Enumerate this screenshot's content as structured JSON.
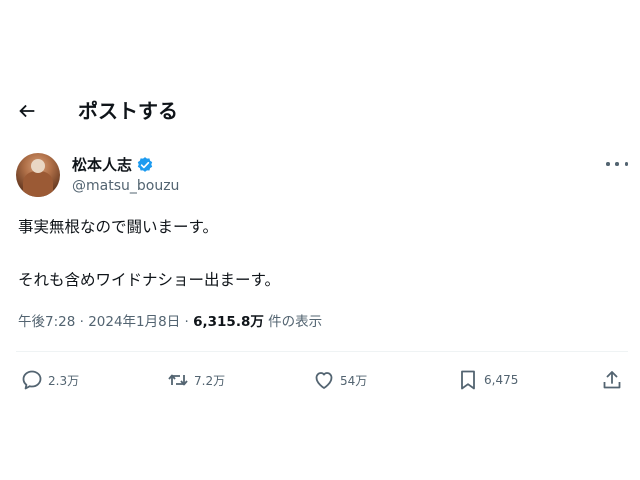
{
  "header": {
    "title": "ポストする",
    "back_icon": "arrow-left-icon"
  },
  "author": {
    "name": "松本人志",
    "handle": "@matsu_bouzu",
    "verified_color": "#1d9bf0"
  },
  "post": {
    "line1": "事実無根なので闘いまーす。",
    "line2": "それも含めワイドナショー出まーす。"
  },
  "meta": {
    "time": "午後7:28",
    "sep1": " · ",
    "date": "2024年1月8日",
    "sep2": " · ",
    "views": "6,315.8万",
    "views_label": " 件の表示"
  },
  "actions": {
    "replies": "2.3万",
    "reposts": "7.2万",
    "likes": "54万",
    "bookmarks": "6,475"
  },
  "colors": {
    "text": "#0f1419",
    "muted": "#536471",
    "divider": "#eff3f4"
  }
}
